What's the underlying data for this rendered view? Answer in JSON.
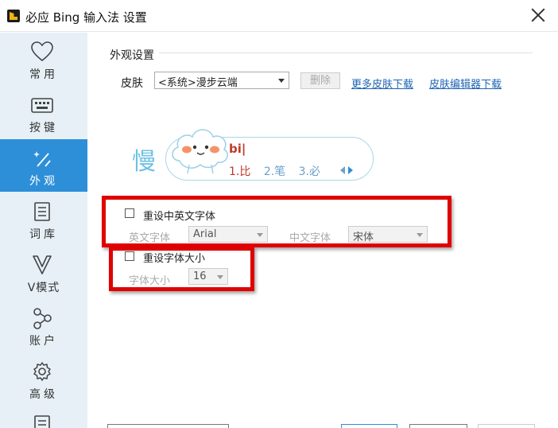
{
  "window": {
    "title": "必应 Bing 输入法 设置"
  },
  "sidebar": {
    "items": [
      {
        "label": "常用",
        "icon": "heart-icon"
      },
      {
        "label": "按键",
        "icon": "keyboard-icon"
      },
      {
        "label": "外观",
        "icon": "appearance-wand-icon",
        "active": true
      },
      {
        "label": "词库",
        "icon": "dictionary-icon"
      },
      {
        "label": "V模式",
        "icon": "v-mode-icon"
      },
      {
        "label": "账户",
        "icon": "account-share-icon"
      },
      {
        "label": "高级",
        "icon": "gear-icon"
      }
    ]
  },
  "appearance": {
    "section_title": "外观设置",
    "skin_label": "皮肤",
    "skin_value": "<系统>漫步云端",
    "delete_label": "删除",
    "more_skins_link": "更多皮肤下载",
    "skin_editor_link": "皮肤编辑器下载"
  },
  "preview": {
    "big_char": "慢",
    "input": "bi|",
    "candidates": [
      "1.比",
      "2.笔",
      "3.必"
    ]
  },
  "font_settings": {
    "reset_font_label": "重设中英文字体",
    "english_font_label": "英文字体",
    "english_font_value": "Arial",
    "chinese_font_label": "中文字体",
    "chinese_font_value": "宋体",
    "reset_size_label": "重设字体大小",
    "size_label": "字体大小",
    "size_value": "16"
  },
  "colors": {
    "accent": "#2d8fd8",
    "sidebar_bg": "#e7f0f6",
    "highlight_red": "#e00000",
    "link": "#1e64b4"
  }
}
